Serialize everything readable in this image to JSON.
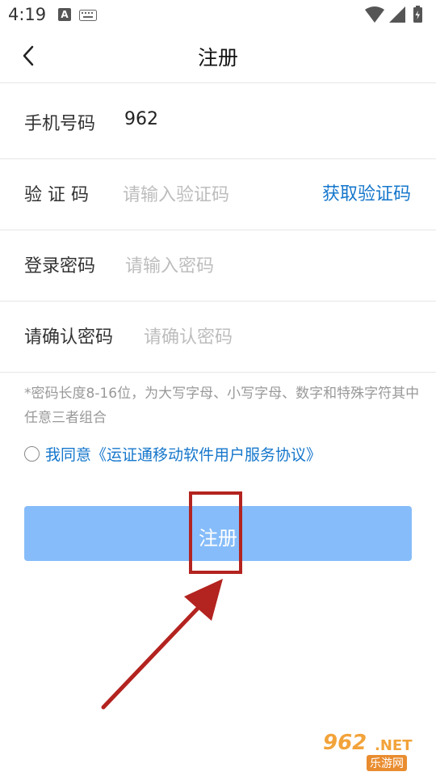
{
  "status_bar": {
    "time": "4:19",
    "a_icon_label": "A"
  },
  "header": {
    "title": "注册"
  },
  "form": {
    "phone": {
      "label": "手机号码",
      "value": "962"
    },
    "code": {
      "label": "验 证 码",
      "placeholder": "请输入验证码",
      "action": "获取验证码"
    },
    "password": {
      "label": "登录密码",
      "placeholder": "请输入密码"
    },
    "confirm": {
      "label": "请确认密码",
      "placeholder": "请确认密码"
    }
  },
  "hint": "*密码长度8-16位，为大写字母、小写字母、数字和特殊字符其中任意三者组合",
  "agreement": {
    "text": "我同意《运证通移动软件用户服务协议》",
    "checked": false
  },
  "register_button": {
    "label": "注册"
  },
  "watermark": {
    "number": "962",
    "domain": ".NET",
    "sub": "乐游网"
  },
  "colors": {
    "accent": "#1677cc",
    "button": "#86bcf9",
    "annotation": "#b3231f",
    "watermark": "#f2a33a"
  }
}
